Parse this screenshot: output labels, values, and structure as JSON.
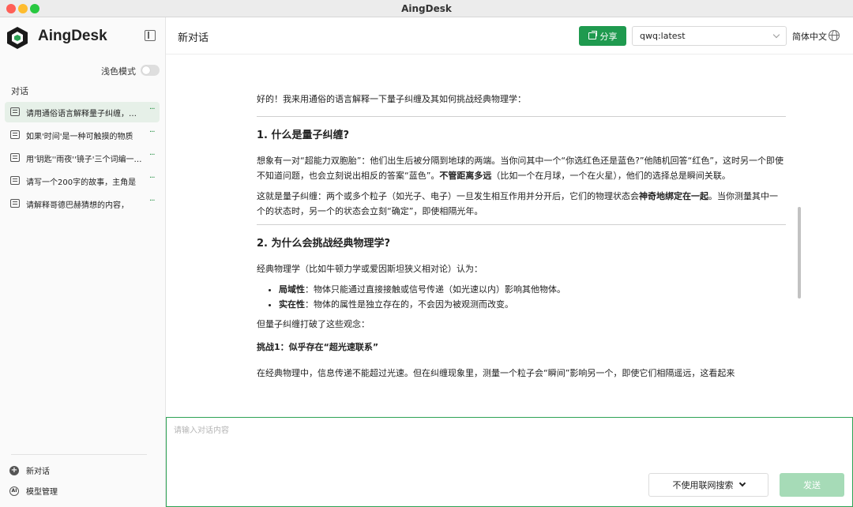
{
  "window": {
    "title": "AingDesk"
  },
  "sidebar": {
    "brand": "AingDesk",
    "theme_label": "浅色模式",
    "section_label": "对话",
    "conversations": [
      {
        "title": "请用通俗语言解释量子纠缠，并说明它如何挑战经典物理学"
      },
      {
        "title": "如果'时间'是一种可触摸的物质"
      },
      {
        "title": "用'钥匙''雨夜''镜子'三个词编一个故事"
      },
      {
        "title": "请写一个200字的故事，主角是"
      },
      {
        "title": "请解释哥德巴赫猜想的内容，"
      }
    ],
    "more_label": "···",
    "new_chat": "新对话",
    "model_manage": "模型管理"
  },
  "header": {
    "title": "新对话",
    "share_label": "分享",
    "model_value": "qwq:latest",
    "language": "简体中文"
  },
  "article": {
    "intro": "好的！我来用通俗的语言解释一下量子纠缠及其如何挑战经典物理学：",
    "h1": "1. 什么是量子纠缠?",
    "p1a": "想象有一对“超能力双胞胎”：他们出生后被分隔到地球的两端。当你问其中一个“你选红色还是蓝色?”他随机回答“红色”，这时另一个即使不知道问题，也会立刻说出相反的答案“蓝色”。",
    "p1b": "不管距离多远",
    "p1c": "（比如一个在月球，一个在火星），他们的选择总是瞬间关联。",
    "p2a": "这就是量子纠缠：两个或多个粒子（如光子、电子）一旦发生相互作用并分开后，它们的物理状态会",
    "p2b": "神奇地绑定在一起",
    "p2c": "。当你测量其中一个的状态时，另一个的状态会立刻“确定”，即使相隔光年。",
    "h2": "2. 为什么会挑战经典物理学?",
    "p3": "经典物理学（比如牛顿力学或爱因斯坦狭义相对论）认为：",
    "li1_label": "局域性",
    "li1_text": "：物体只能通过直接接触或信号传递（如光速以内）影响其他物体。",
    "li2_label": "实在性",
    "li2_text": "：物体的属性是独立存在的，不会因为被观测而改变。",
    "p4": "但量子纠缠打破了这些观念：",
    "challenge": "挑战1：似乎存在“超光速联系”",
    "p5": "在经典物理中，信息传递不能超过光速。但在纠缠现象里，测量一个粒子会“瞬间”影响另一个，即使它们相隔遥远，这看起来"
  },
  "composer": {
    "placeholder": "请输入对话内容",
    "web_search": "不使用联网搜索",
    "send": "发送"
  },
  "colors": {
    "accent": "#1f9a4f",
    "active_bg": "#e6f0e8",
    "send_disabled": "#a6dbb7"
  }
}
